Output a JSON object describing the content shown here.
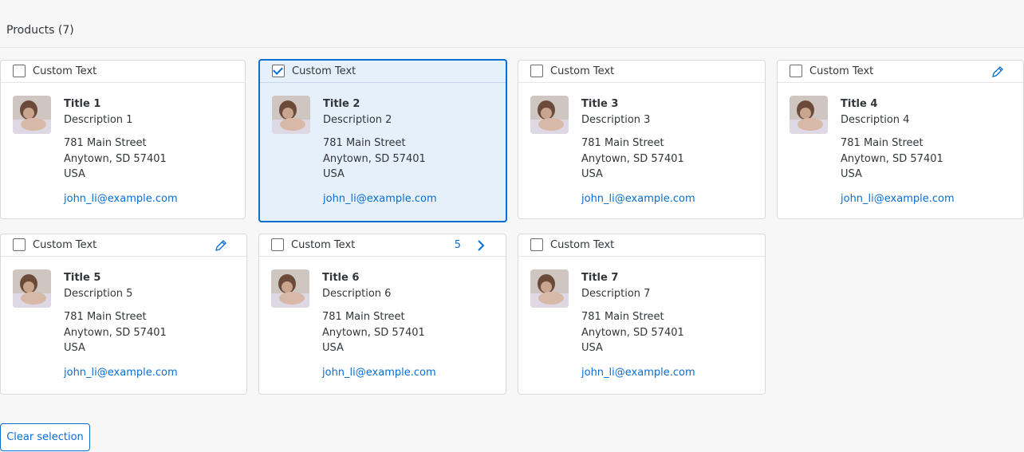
{
  "header": {
    "title": "Products (7)"
  },
  "cards": [
    {
      "header_text": "Custom Text",
      "title": "Title 1",
      "description": "Description 1",
      "street": "781 Main Street",
      "city": "Anytown, SD 57401",
      "country": "USA",
      "email": "john_li@example.com",
      "selected": false
    },
    {
      "header_text": "Custom Text",
      "title": "Title 2",
      "description": "Description 2",
      "street": "781 Main Street",
      "city": "Anytown, SD 57401",
      "country": "USA",
      "email": "john_li@example.com",
      "selected": true
    },
    {
      "header_text": "Custom Text",
      "title": "Title 3",
      "description": "Description 3",
      "street": "781 Main Street",
      "city": "Anytown, SD 57401",
      "country": "USA",
      "email": "john_li@example.com",
      "selected": false
    },
    {
      "header_text": "Custom Text",
      "title": "Title 4",
      "description": "Description 4",
      "street": "781 Main Street",
      "city": "Anytown, SD 57401",
      "country": "USA",
      "email": "john_li@example.com",
      "selected": false,
      "icon": "edit-icon"
    },
    {
      "header_text": "Custom Text",
      "title": "Title 5",
      "description": "Description 5",
      "street": "781 Main Street",
      "city": "Anytown, SD 57401",
      "country": "USA",
      "email": "john_li@example.com",
      "selected": false,
      "icon": "edit-icon"
    },
    {
      "header_text": "Custom Text",
      "title": "Title 6",
      "description": "Description 6",
      "street": "781 Main Street",
      "city": "Anytown, SD 57401",
      "country": "USA",
      "email": "john_li@example.com",
      "selected": false,
      "counter": "5",
      "icon": "chevron-right-icon"
    },
    {
      "header_text": "Custom Text",
      "title": "Title 7",
      "description": "Description 7",
      "street": "781 Main Street",
      "city": "Anytown, SD 57401",
      "country": "USA",
      "email": "john_li@example.com",
      "selected": false
    }
  ],
  "footer": {
    "clear_label": "Clear selection"
  },
  "colors": {
    "accent": "#0a6ed1",
    "selected_bg": "#e5f0fa",
    "text": "#32363a",
    "page_bg": "#f7f7f7"
  }
}
